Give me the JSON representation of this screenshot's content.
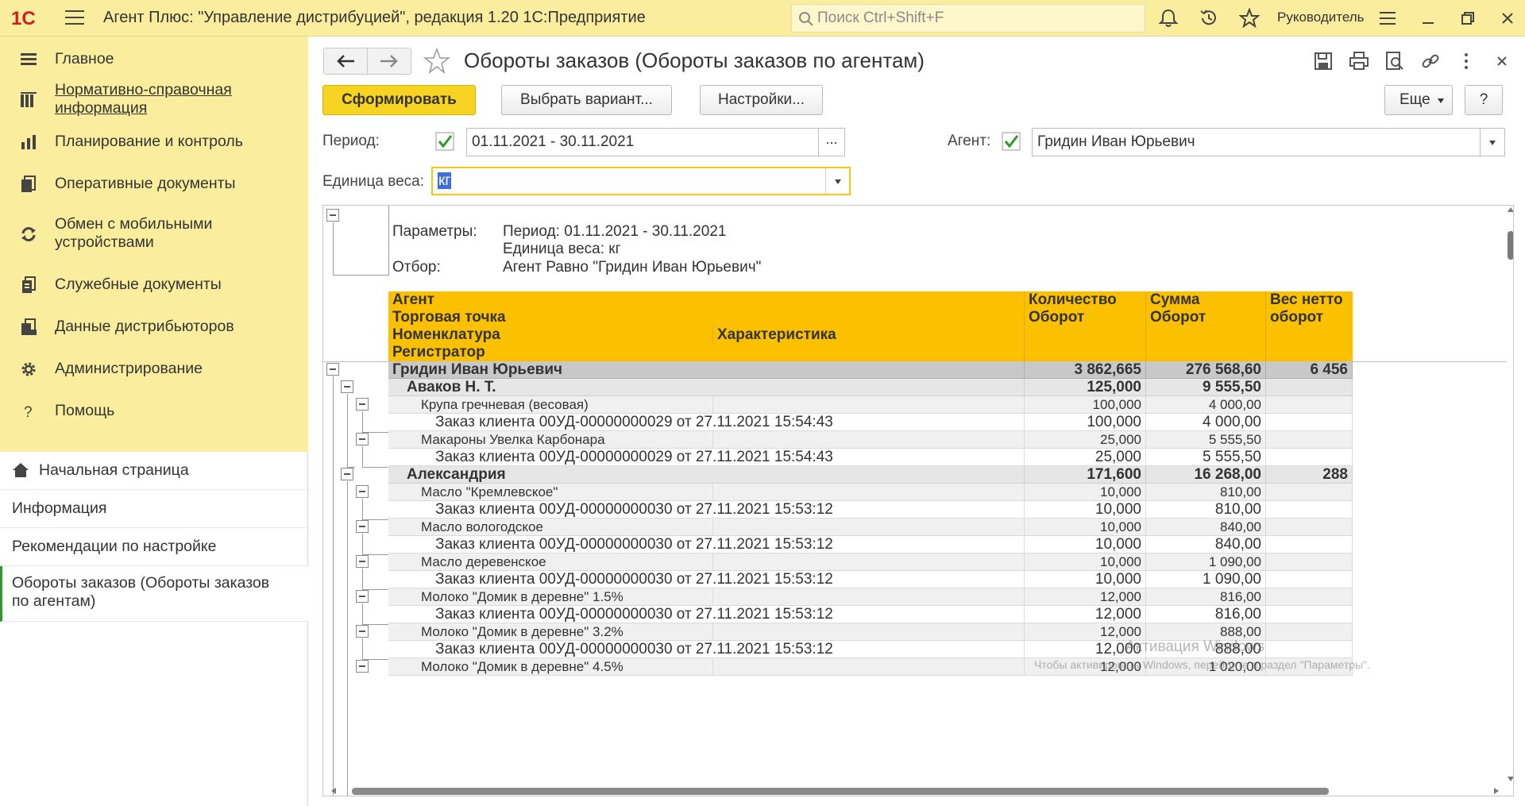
{
  "app": {
    "title": "Агент Плюс: \"Управление дистрибуцией\", редакция 1.20 1С:Предприятие",
    "logo_text": "1С",
    "search_placeholder": "Поиск Ctrl+Shift+F",
    "user": "Руководитель"
  },
  "sidebar": {
    "sections": [
      {
        "label": "Главное",
        "icon": "hamburger-icon"
      },
      {
        "label": "Нормативно-справочная информация",
        "icon": "reference-books-icon"
      },
      {
        "label": "Планирование и контроль",
        "icon": "bar-chart-icon"
      },
      {
        "label": "Оперативные документы",
        "icon": "documents-icon"
      },
      {
        "label": "Обмен с мобильными устройствами",
        "icon": "sync-icon"
      },
      {
        "label": "Служебные документы",
        "icon": "service-documents-icon"
      },
      {
        "label": "Данные дистрибьюторов",
        "icon": "distributor-data-icon"
      },
      {
        "label": "Администрирование",
        "icon": "gear-icon"
      },
      {
        "label": "Помощь",
        "icon": "question-icon"
      }
    ],
    "open_windows": [
      {
        "label": "Начальная страница",
        "icon": "home-icon"
      },
      {
        "label": "Информация"
      },
      {
        "label": "Рекомендации по настройке"
      },
      {
        "label": "Обороты заказов (Обороты заказов по агентам)"
      }
    ]
  },
  "form": {
    "title": "Обороты заказов (Обороты заказов по агентам)",
    "buttons": {
      "generate": "Сформировать",
      "choose_variant": "Выбрать вариант...",
      "settings": "Настройки...",
      "more": "Еще",
      "help": "?"
    },
    "period": {
      "label": "Период:",
      "value": "01.11.2021 - 30.11.2021",
      "button": "..."
    },
    "agent": {
      "label": "Агент:",
      "value": "Гридин Иван Юрьевич"
    },
    "weight_unit": {
      "label": "Единица веса:",
      "value": "кг"
    }
  },
  "report": {
    "params_label": "Параметры:",
    "params_period": "Период: 01.11.2021 - 30.11.2021",
    "params_unit": "Единица веса: кг",
    "filter_label": "Отбор:",
    "filter_value": "Агент Равно \"Гридин Иван Юрьевич\"",
    "headers": {
      "agent": "Агент",
      "outlet": "Торговая точка",
      "nomenclature": "Номенклатура",
      "characteristic": "Характеристика",
      "registrar": "Регистратор",
      "qty_1": "Количество",
      "qty_2": "Оборот",
      "sum_1": "Сумма",
      "sum_2": "Оборот",
      "weight_1": "Вес нетто",
      "weight_2": "оборот"
    },
    "rows": [
      {
        "level": 1,
        "name": "Гридин Иван Юрьевич",
        "qty": "3 862,665",
        "sum": "276 568,60",
        "weight": "6 456"
      },
      {
        "level": 2,
        "name": "Аваков Н. Т.",
        "qty": "125,000",
        "sum": "9 555,50",
        "weight": ""
      },
      {
        "level": 3,
        "name": "Крупа гречневая (весовая)",
        "qty": "100,000",
        "sum": "4 000,00",
        "weight": ""
      },
      {
        "level": 4,
        "name": "Заказ клиента 00УД-00000000029 от 27.11.2021 15:54:43",
        "qty": "100,000",
        "sum": "4 000,00",
        "weight": ""
      },
      {
        "level": 3,
        "name": "Макароны Увелка Карбонара",
        "qty": "25,000",
        "sum": "5 555,50",
        "weight": ""
      },
      {
        "level": 4,
        "name": "Заказ клиента 00УД-00000000029 от 27.11.2021 15:54:43",
        "qty": "25,000",
        "sum": "5 555,50",
        "weight": ""
      },
      {
        "level": 2,
        "name": "Александрия",
        "qty": "171,600",
        "sum": "16 268,00",
        "weight": "288"
      },
      {
        "level": 3,
        "name": "Масло \"Кремлевское\"",
        "qty": "10,000",
        "sum": "810,00",
        "weight": ""
      },
      {
        "level": 4,
        "name": "Заказ клиента 00УД-00000000030 от 27.11.2021 15:53:12",
        "qty": "10,000",
        "sum": "810,00",
        "weight": ""
      },
      {
        "level": 3,
        "name": "Масло вологодское",
        "qty": "10,000",
        "sum": "840,00",
        "weight": ""
      },
      {
        "level": 4,
        "name": "Заказ клиента 00УД-00000000030 от 27.11.2021 15:53:12",
        "qty": "10,000",
        "sum": "840,00",
        "weight": ""
      },
      {
        "level": 3,
        "name": "Масло деревенское",
        "qty": "10,000",
        "sum": "1 090,00",
        "weight": ""
      },
      {
        "level": 4,
        "name": "Заказ клиента 00УД-00000000030 от 27.11.2021 15:53:12",
        "qty": "10,000",
        "sum": "1 090,00",
        "weight": ""
      },
      {
        "level": 3,
        "name": "Молоко \"Домик в деревне\" 1.5%",
        "qty": "12,000",
        "sum": "816,00",
        "weight": ""
      },
      {
        "level": 4,
        "name": "Заказ клиента 00УД-00000000030 от 27.11.2021 15:53:12",
        "qty": "12,000",
        "sum": "816,00",
        "weight": ""
      },
      {
        "level": 3,
        "name": "Молоко \"Домик в деревне\" 3.2%",
        "qty": "12,000",
        "sum": "888,00",
        "weight": ""
      },
      {
        "level": 4,
        "name": "Заказ клиента 00УД-00000000030 от 27.11.2021 15:53:12",
        "qty": "12,000",
        "sum": "888,00",
        "weight": ""
      },
      {
        "level": 3,
        "name": "Молоко \"Домик в деревне\" 4.5%",
        "qty": "12,000",
        "sum": "1 020,00",
        "weight": ""
      }
    ]
  },
  "watermark": {
    "line1": "Активация Windows",
    "line2": "Чтобы активировать Windows, перейдите в раздел \"Параметры\"."
  }
}
